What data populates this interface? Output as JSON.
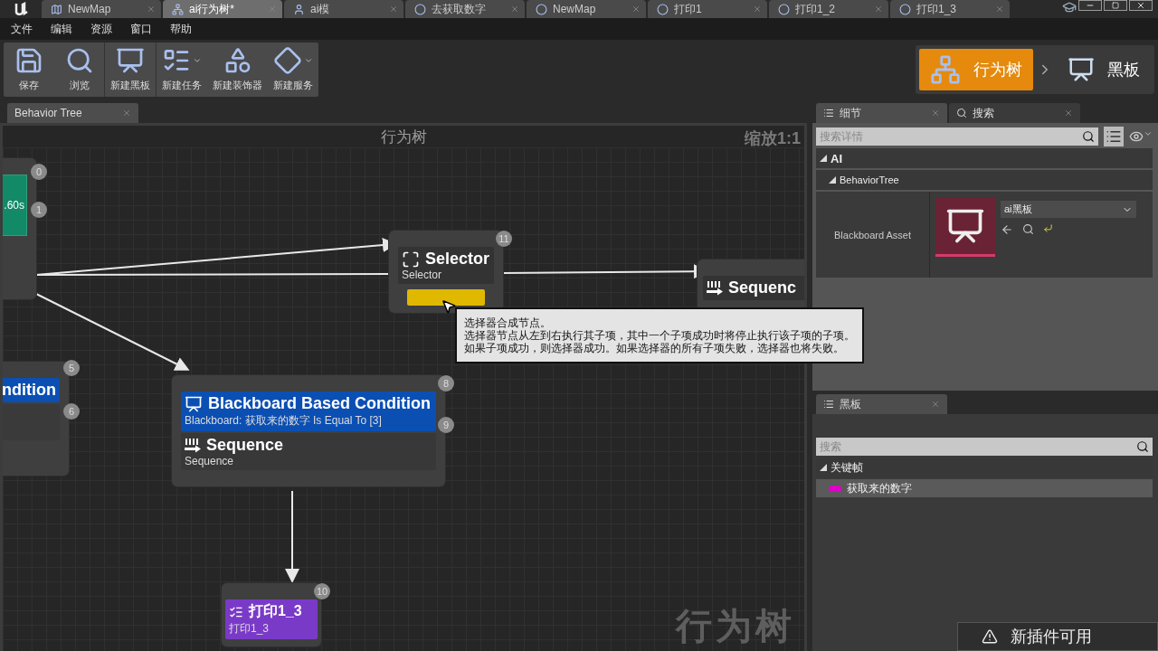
{
  "title_bar": {
    "tabs": [
      {
        "label": "NewMap",
        "kind": "map",
        "selected": false
      },
      {
        "label": "ai行为树*",
        "kind": "tree",
        "selected": true
      },
      {
        "label": "ai模",
        "kind": "blueprint",
        "selected": false
      },
      {
        "label": "去获取数字",
        "kind": "task",
        "selected": false
      },
      {
        "label": "NewMap",
        "kind": "level",
        "selected": false
      },
      {
        "label": "打印1",
        "kind": "task",
        "selected": false
      },
      {
        "label": "打印1_2",
        "kind": "task",
        "selected": false
      },
      {
        "label": "打印1_3",
        "kind": "task",
        "selected": false
      }
    ]
  },
  "menu": [
    "文件",
    "编辑",
    "资源",
    "窗口",
    "帮助"
  ],
  "toolbar": [
    {
      "label": "保存",
      "dropdown": false
    },
    {
      "label": "浏览",
      "dropdown": false
    },
    {
      "label": "新建黑板",
      "dropdown": false
    },
    {
      "label": "新建任务",
      "dropdown": true
    },
    {
      "label": "新建装饰器",
      "dropdown": false
    },
    {
      "label": "新建服务",
      "dropdown": true
    }
  ],
  "modes": [
    {
      "label": "行为树",
      "selected": true
    },
    {
      "label": "黑板",
      "selected": false
    }
  ],
  "graph": {
    "tab": "Behavior Tree",
    "title": "行为树",
    "zoom": "缩放1:1",
    "watermark": "行为树",
    "nodes": [
      {
        "kind": "root_partial",
        "badges": [
          "0",
          "1"
        ],
        "time": ".60s"
      },
      {
        "kind": "composite",
        "badge": "11",
        "title": "Selector",
        "subtitle": "Selector",
        "active": true
      },
      {
        "kind": "composite",
        "title": "Sequenc",
        "active": false
      },
      {
        "kind": "decorator_partial",
        "badges": [
          "5",
          "6"
        ],
        "title": "ndition"
      },
      {
        "kind": "decorated_composite",
        "badges": [
          "8",
          "9"
        ],
        "decorator": {
          "title": "Blackboard Based Condition",
          "subtitle": "Blackboard: 获取来的数字 Is Equal To [3]"
        },
        "title": "Sequence",
        "subtitle": "Sequence"
      },
      {
        "kind": "task",
        "badge": "10",
        "title": "打印1_3",
        "subtitle": "打印1_3"
      }
    ]
  },
  "tooltip": {
    "lines": [
      "选择器合成节点。",
      "选择器节点从左到右执行其子项，其中一个子项成功时将停止执行该子项的子项。",
      "如果子项成功，则选择器成功。如果选择器的所有子项失败，选择器也将失败。"
    ]
  },
  "details": {
    "tabs": [
      {
        "label": "细节",
        "selected": true
      },
      {
        "label": "搜索",
        "selected": false
      }
    ],
    "search": {
      "placeholder": "搜索详情"
    },
    "category": "AI",
    "subcategory": "BehaviorTree",
    "property": {
      "label": "Blackboard Asset",
      "value": "ai黑板"
    }
  },
  "blackboard": {
    "tab": "黑板",
    "search": {
      "placeholder": "搜索"
    },
    "category": "关键帧",
    "keys": [
      {
        "name": "获取来的数字",
        "color": "#e000c8"
      }
    ]
  },
  "notification": {
    "text": "新插件可用"
  }
}
